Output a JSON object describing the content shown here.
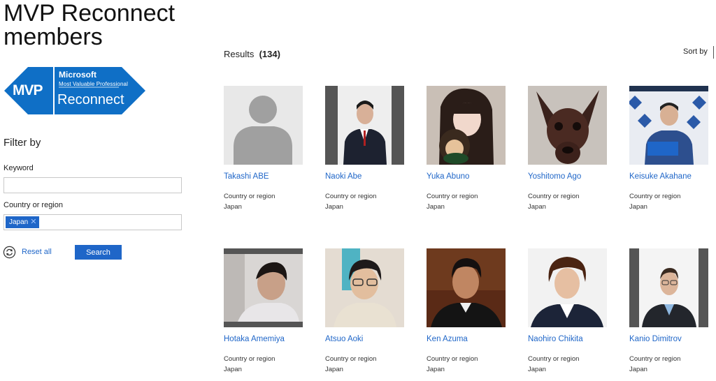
{
  "page": {
    "title_line1": "MVP Reconnect",
    "title_line2": "members"
  },
  "logo": {
    "mvp": "MVP",
    "microsoft": "Microsoft",
    "program": "Most Valuable Professional",
    "reconnect": "Reconnect",
    "color": "#0f6fc6"
  },
  "filter": {
    "heading": "Filter by",
    "keyword_label": "Keyword",
    "keyword_value": "",
    "country_label": "Country or region",
    "country_chip": "Japan",
    "reset_label": "Reset all",
    "search_label": "Search"
  },
  "results": {
    "label": "Results",
    "count": "(134)",
    "sort_label": "Sort by"
  },
  "members": [
    {
      "name": "Takashi ABE",
      "country_label": "Country or region",
      "country": "Japan"
    },
    {
      "name": "Naoki Abe",
      "country_label": "Country or region",
      "country": "Japan"
    },
    {
      "name": "Yuka Abuno",
      "country_label": "Country or region",
      "country": "Japan"
    },
    {
      "name": "Yoshitomo Ago",
      "country_label": "Country or region",
      "country": "Japan"
    },
    {
      "name": "Keisuke Akahane",
      "country_label": "Country or region",
      "country": "Japan"
    },
    {
      "name": "Hotaka Amemiya",
      "country_label": "Country or region",
      "country": "Japan"
    },
    {
      "name": "Atsuo Aoki",
      "country_label": "Country or region",
      "country": "Japan"
    },
    {
      "name": "Ken Azuma",
      "country_label": "Country or region",
      "country": "Japan"
    },
    {
      "name": "Naohiro Chikita",
      "country_label": "Country or region",
      "country": "Japan"
    },
    {
      "name": "Kanio Dimitrov",
      "country_label": "Country or region",
      "country": "Japan"
    }
  ],
  "colors": {
    "link": "#1f66c8",
    "button": "#1f66c8"
  }
}
